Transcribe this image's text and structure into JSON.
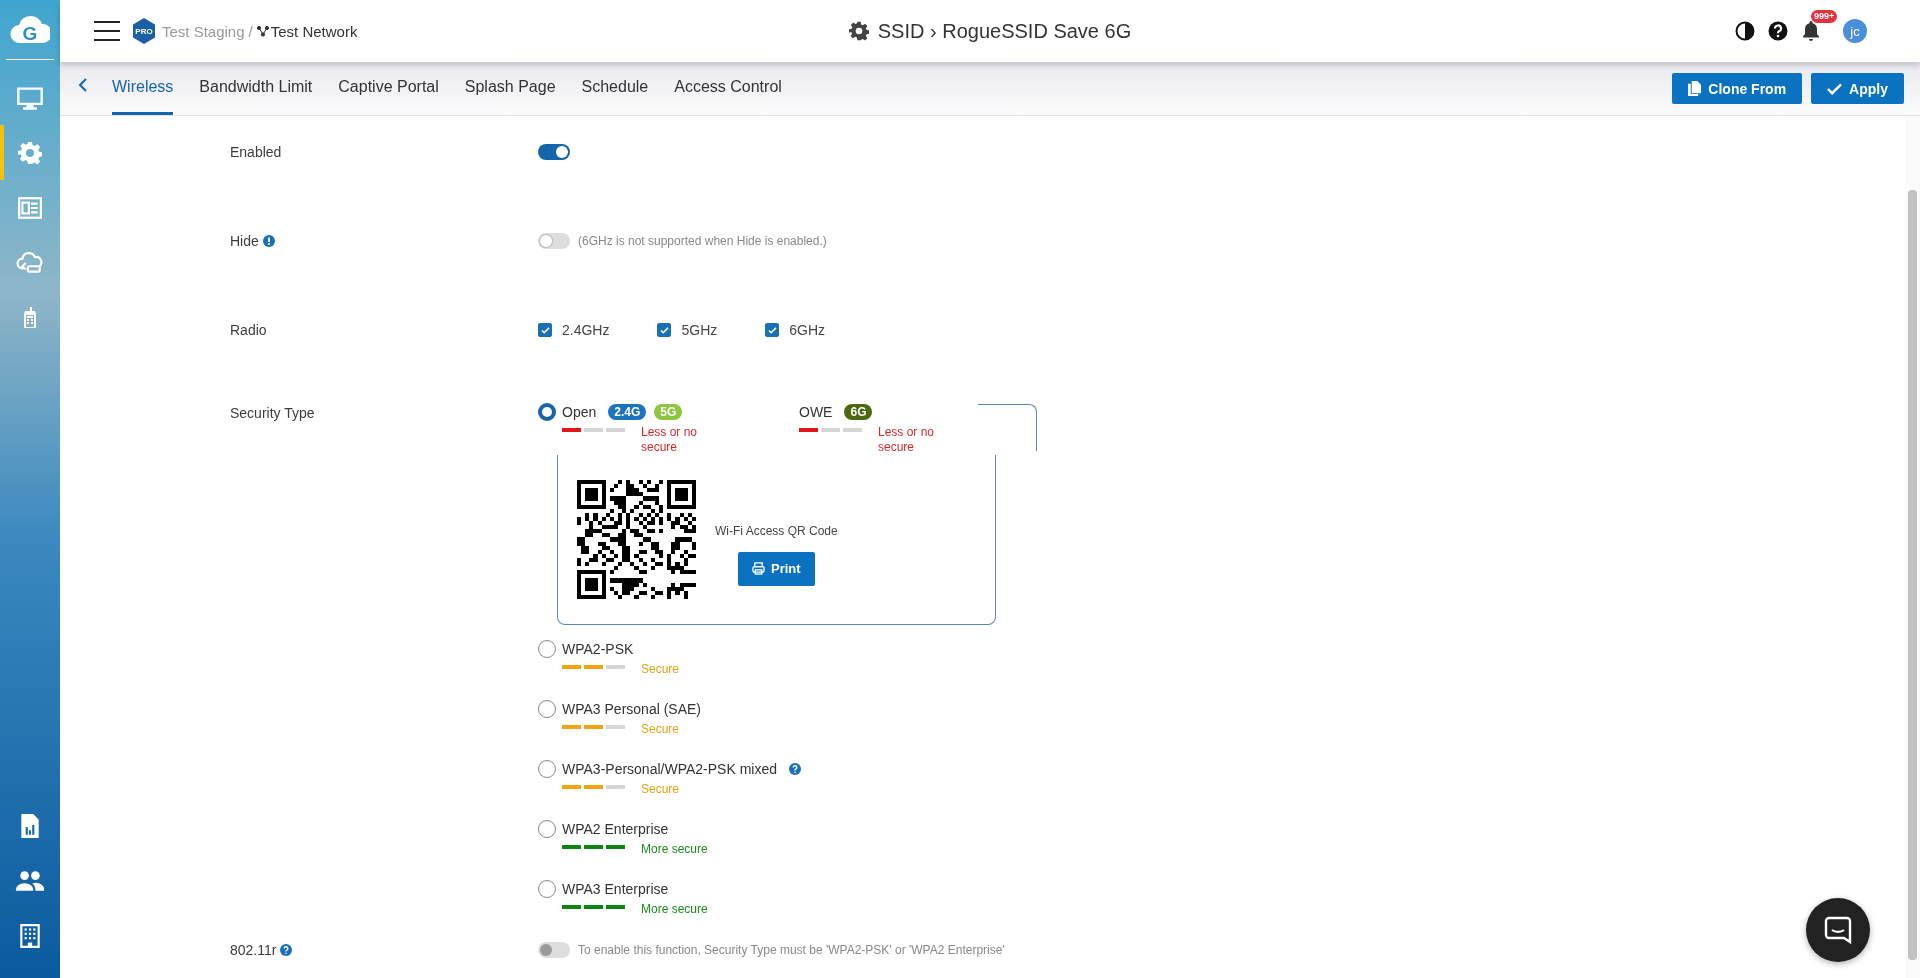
{
  "sidebar": {
    "logo": "G",
    "items": [
      {
        "kind": "monitor",
        "selected": false
      },
      {
        "kind": "gear",
        "selected": true
      },
      {
        "kind": "news",
        "selected": false
      },
      {
        "kind": "cloud",
        "selected": false
      },
      {
        "kind": "phone",
        "selected": false
      }
    ],
    "bottom_items": [
      {
        "kind": "report",
        "selected": false
      },
      {
        "kind": "people",
        "selected": false
      },
      {
        "kind": "building",
        "selected": false
      }
    ]
  },
  "header": {
    "badge": "PRO",
    "breadcrumb": [
      {
        "text": "Test Staging"
      },
      {
        "text": "/"
      },
      {
        "text": "Test Network"
      }
    ],
    "title": "SSID › RogueSSID Save 6G",
    "notifications": "999+",
    "avatar": "jc"
  },
  "tabs": [
    {
      "label": "Wireless",
      "selected": true
    },
    {
      "label": "Bandwidth Limit",
      "selected": false
    },
    {
      "label": "Captive Portal",
      "selected": false
    },
    {
      "label": "Splash Page",
      "selected": false
    },
    {
      "label": "Schedule",
      "selected": false
    },
    {
      "label": "Access Control",
      "selected": false
    }
  ],
  "actions": [
    {
      "label": "Clone From",
      "kind": "clone"
    },
    {
      "label": "Apply",
      "kind": "check"
    }
  ],
  "settings": {
    "enabled": {
      "label": "Enabled",
      "on": true,
      "disabled": false
    },
    "hide": {
      "label": "Hide",
      "on": false,
      "disabled": false,
      "note": "(6GHz is not supported when Hide is enabled.)"
    },
    "radio": {
      "label": "Radio",
      "options": [
        {
          "label": "2.4GHz",
          "checked": true
        },
        {
          "label": "5GHz",
          "checked": true
        },
        {
          "label": "6GHz",
          "checked": true
        }
      ]
    },
    "security_type": {
      "label": "Security Type",
      "options": [
        {
          "label": "Open",
          "selected": true,
          "help": false,
          "badges": [
            {
              "text": "2.4G",
              "color": "#1b74c0"
            },
            {
              "text": "5G",
              "color": "#8cc63e"
            }
          ],
          "level": 0.33,
          "rating": "Less or no secure",
          "paired": {
            "label": "OWE",
            "badges": [
              {
                "text": "6G",
                "color": "#4b6a10"
              }
            ],
            "level": 0.33,
            "rating": "Less or no secure"
          },
          "qr": {
            "caption": "Wi-Fi Access QR Code",
            "button": "Print"
          }
        },
        {
          "label": "WPA2-PSK",
          "selected": false,
          "help": false,
          "level": 0.67,
          "rating": "Secure"
        },
        {
          "label": "WPA3 Personal (SAE)",
          "selected": false,
          "help": false,
          "level": 0.67,
          "rating": "Secure"
        },
        {
          "label": "WPA3-Personal/WPA2-PSK mixed",
          "selected": false,
          "help": true,
          "level": 0.67,
          "rating": "Secure"
        },
        {
          "label": "WPA2 Enterprise",
          "selected": false,
          "help": false,
          "level": 1,
          "rating": "More secure"
        },
        {
          "label": "WPA3 Enterprise",
          "selected": false,
          "help": false,
          "level": 1,
          "rating": "More secure"
        }
      ]
    },
    "fast_roaming": {
      "label": "802.11r",
      "on": false,
      "disabled": true,
      "note": "To enable this function, Security Type must be 'WPA2-PSK' or 'WPA2 Enterprise'"
    }
  }
}
